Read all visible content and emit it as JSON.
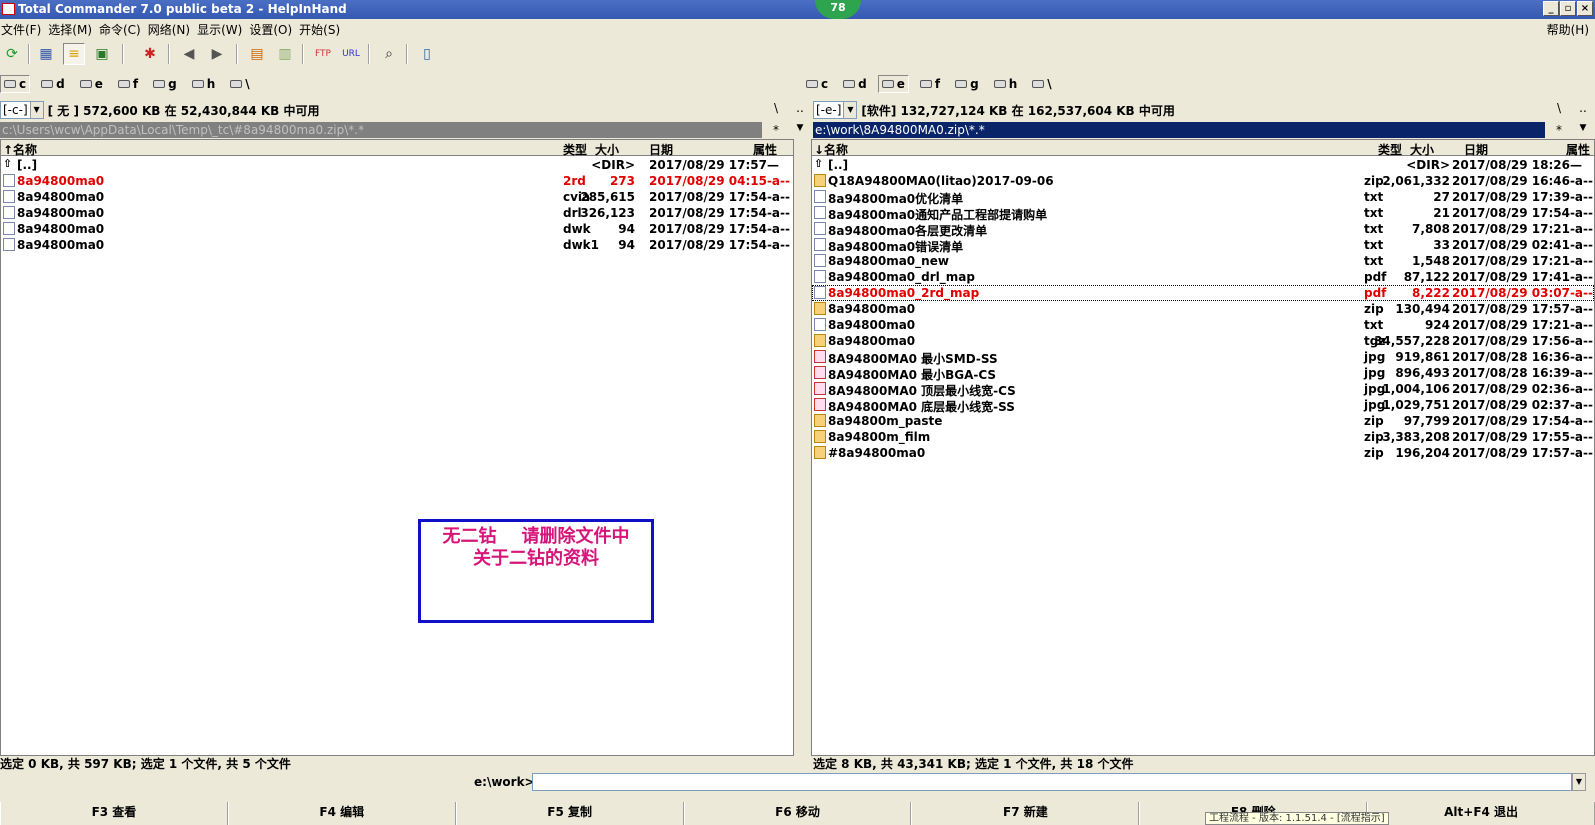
{
  "window": {
    "title": "Total Commander 7.0 public beta 2 - HelpInHand",
    "badge": "78",
    "buttons": [
      "_",
      "▫",
      "×"
    ]
  },
  "menu": {
    "items": [
      "文件(F)",
      "选择(M)",
      "命令(C)",
      "网络(N)",
      "显示(W)",
      "设置(O)",
      "开始(S)"
    ],
    "help": "帮助(H)"
  },
  "toolbar": {
    "icons": [
      "refresh-icon",
      "brief-view-icon",
      "detail-view-icon",
      "thumbnail-view-icon",
      "compare-icon",
      "back-icon",
      "forward-icon",
      "pack-icon",
      "unpack-icon",
      "ftp-icon",
      "url-icon",
      "find-icon",
      "notepad-icon"
    ]
  },
  "left": {
    "drives": [
      "c",
      "d",
      "e",
      "f",
      "g",
      "h",
      "\\"
    ],
    "active_drive": "c",
    "combo": "[-c-]",
    "free_info": "[ 无 ]  572,600 KB 在 52,430,844 KB 中可用",
    "root_btn": "\\",
    "up_btn": "..",
    "path": "c:\\Users\\wcw\\AppData\\Local\\Temp\\_tc\\#8a94800ma0.zip\\*.*",
    "star_btn": "*",
    "hist_btn": "▼",
    "headers": {
      "name": "↑名称",
      "type": "类型",
      "size": "大小",
      "date": "日期",
      "attr": "属性"
    },
    "files": [
      {
        "name": "[..]",
        "type": "",
        "size": "<DIR>",
        "date": "2017/08/29 17:57—",
        "icon": "up",
        "red": false
      },
      {
        "name": "8a94800ma0",
        "type": "2rd",
        "size": "273",
        "date": "2017/08/29 04:15-a--",
        "icon": "file",
        "red": true
      },
      {
        "name": "8a94800ma0",
        "type": "cvia",
        "size": "285,615",
        "date": "2017/08/29 17:54-a--",
        "icon": "file",
        "red": false
      },
      {
        "name": "8a94800ma0",
        "type": "drl",
        "size": "326,123",
        "date": "2017/08/29 17:54-a--",
        "icon": "file",
        "red": false
      },
      {
        "name": "8a94800ma0",
        "type": "dwk",
        "size": "94",
        "date": "2017/08/29 17:54-a--",
        "icon": "file",
        "red": false
      },
      {
        "name": "8a94800ma0",
        "type": "dwk1",
        "size": "94",
        "date": "2017/08/29 17:54-a--",
        "icon": "file",
        "red": false
      }
    ],
    "status": "选定 0 KB, 共 597 KB; 选定 1 个文件, 共 5 个文件"
  },
  "right": {
    "drives": [
      "c",
      "d",
      "e",
      "f",
      "g",
      "h",
      "\\"
    ],
    "active_drive": "e",
    "combo": "[-e-]",
    "free_info": "[软件]  132,727,124 KB 在 162,537,604 KB 中可用",
    "root_btn": "\\",
    "up_btn": "..",
    "path": "e:\\work\\8A94800MA0.zip\\*.*",
    "star_btn": "*",
    "hist_btn": "▼",
    "headers": {
      "name": "↓名称",
      "type": "类型",
      "size": "大小",
      "date": "日期",
      "attr": "属性"
    },
    "files": [
      {
        "name": "[..]",
        "type": "",
        "size": "<DIR>",
        "date": "2017/08/29 18:26—",
        "icon": "up",
        "red": false
      },
      {
        "name": "Q18A94800MA0(litao)2017-09-06",
        "type": "zip",
        "size": "2,061,332",
        "date": "2017/08/29 16:46-a--",
        "icon": "zip",
        "red": false
      },
      {
        "name": "8a94800ma0优化清单",
        "type": "txt",
        "size": "27",
        "date": "2017/08/29 17:39-a--",
        "icon": "file",
        "red": false
      },
      {
        "name": "8a94800ma0通知产品工程部提请购单",
        "type": "txt",
        "size": "21",
        "date": "2017/08/29 17:54-a--",
        "icon": "file",
        "red": false
      },
      {
        "name": "8a94800ma0各层更改清单",
        "type": "txt",
        "size": "7,808",
        "date": "2017/08/29 17:21-a--",
        "icon": "file",
        "red": false
      },
      {
        "name": "8a94800ma0错误清单",
        "type": "txt",
        "size": "33",
        "date": "2017/08/29 02:41-a--",
        "icon": "file",
        "red": false
      },
      {
        "name": "8a94800ma0_new",
        "type": "txt",
        "size": "1,548",
        "date": "2017/08/29 17:21-a--",
        "icon": "file",
        "red": false
      },
      {
        "name": "8a94800ma0_drl_map",
        "type": "pdf",
        "size": "87,122",
        "date": "2017/08/29 17:41-a--",
        "icon": "file",
        "red": false
      },
      {
        "name": "8a94800ma0_2rd_map",
        "type": "pdf",
        "size": "8,222",
        "date": "2017/08/29 03:07-a--",
        "icon": "file",
        "red": true,
        "focus": true
      },
      {
        "name": "8a94800ma0",
        "type": "zip",
        "size": "130,494",
        "date": "2017/08/29 17:57-a--",
        "icon": "zip",
        "red": false
      },
      {
        "name": "8a94800ma0",
        "type": "txt",
        "size": "924",
        "date": "2017/08/29 17:21-a--",
        "icon": "file",
        "red": false
      },
      {
        "name": "8a94800ma0",
        "type": "tgz",
        "size": "34,557,228",
        "date": "2017/08/29 17:56-a--",
        "icon": "zip",
        "red": false
      },
      {
        "name": "8A94800MA0 最小SMD-SS",
        "type": "jpg",
        "size": "919,861",
        "date": "2017/08/28 16:36-a--",
        "icon": "jpg",
        "red": false
      },
      {
        "name": "8A94800MA0 最小BGA-CS",
        "type": "jpg",
        "size": "896,493",
        "date": "2017/08/28 16:39-a--",
        "icon": "jpg",
        "red": false
      },
      {
        "name": "8A94800MA0 顶层最小线宽-CS",
        "type": "jpg",
        "size": "1,004,106",
        "date": "2017/08/29 02:36-a--",
        "icon": "jpg",
        "red": false
      },
      {
        "name": "8A94800MA0 底层最小线宽-SS",
        "type": "jpg",
        "size": "1,029,751",
        "date": "2017/08/29 02:37-a--",
        "icon": "jpg",
        "red": false
      },
      {
        "name": "8a94800m_paste",
        "type": "zip",
        "size": "97,799",
        "date": "2017/08/29 17:54-a--",
        "icon": "zip",
        "red": false
      },
      {
        "name": "8a94800m_film",
        "type": "zip",
        "size": "3,383,208",
        "date": "2017/08/29 17:55-a--",
        "icon": "zip",
        "red": false
      },
      {
        "name": "#8a94800ma0",
        "type": "zip",
        "size": "196,204",
        "date": "2017/08/29 17:57-a--",
        "icon": "zip",
        "red": false
      }
    ],
    "status": "选定 8 KB, 共 43,341 KB; 选定 1 个文件, 共 18 个文件"
  },
  "annotation": {
    "line1": "无二钻    请删除文件中",
    "line2": "关于二钻的资料"
  },
  "cmdline": {
    "label": "e:\\work>",
    "value": ""
  },
  "fkeys": [
    "F3 查看",
    "F4 编辑",
    "F5 复制",
    "F6 移动",
    "F7 新建",
    "F8 删除",
    "Alt+F4 退出"
  ],
  "tooltip": "工程流程 - 版本: 1.1.51.4 - [流程指示]"
}
